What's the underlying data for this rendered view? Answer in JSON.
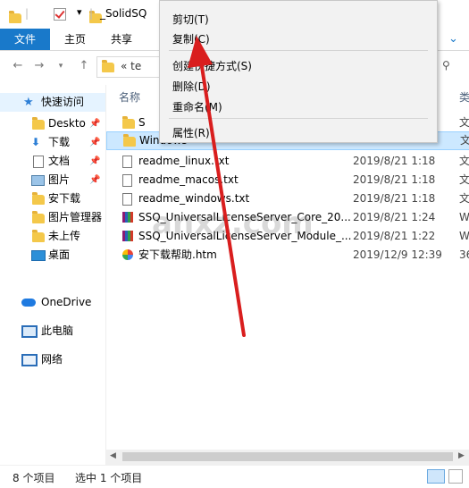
{
  "titlebar": {
    "path": "_SolidSQ"
  },
  "ribbon": {
    "tabs": [
      "文件",
      "主页",
      "共享"
    ]
  },
  "address": {
    "text": "«  te"
  },
  "sidebar": {
    "quick_access": "快速访问",
    "items": [
      "Deskto",
      "下载",
      "文档",
      "图片",
      "安下载",
      "图片管理器",
      "未上传",
      "桌面"
    ],
    "onedrive": "OneDrive",
    "thispc": "此电脑",
    "network": "网络"
  },
  "columns": {
    "name": "名称",
    "type": "类"
  },
  "files": [
    {
      "name": "S",
      "date": "",
      "type": "文"
    },
    {
      "name": "Windows",
      "date": "",
      "type": "文"
    },
    {
      "name": "readme_linux.txt",
      "date": "2019/8/21 1:18",
      "type": "文"
    },
    {
      "name": "readme_macos.txt",
      "date": "2019/8/21 1:18",
      "type": "文"
    },
    {
      "name": "readme_windows.txt",
      "date": "2019/8/21 1:18",
      "type": "文"
    },
    {
      "name": "SSQ_UniversalLicenseServer_Core_20...",
      "date": "2019/8/21 1:24",
      "type": "W"
    },
    {
      "name": "SSQ_UniversalLicenseServer_Module_...",
      "date": "2019/8/21 1:22",
      "type": "W"
    },
    {
      "name": "安下载帮助.htm",
      "date": "2019/12/9 12:39",
      "type": "36"
    }
  ],
  "context_menu": {
    "cut": "剪切(T)",
    "copy": "复制(C)",
    "shortcut": "创建快捷方式(S)",
    "delete": "删除(D)",
    "rename": "重命名(M)",
    "properties": "属性(R)"
  },
  "status": {
    "count": "8 个项目",
    "selected": "选中 1 个项目"
  },
  "watermark": "anxz.com",
  "colors": {
    "accent": "#1979ca",
    "selection": "#cce8ff",
    "arrow": "#d91e1e"
  }
}
